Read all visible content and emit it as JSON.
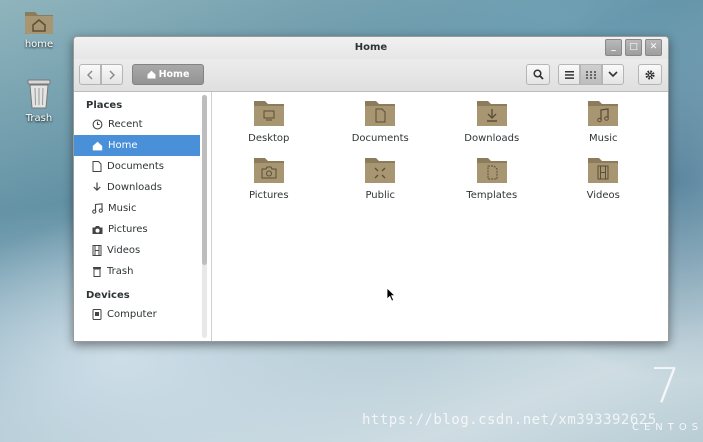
{
  "desktop": {
    "home_label": "home",
    "trash_label": "Trash"
  },
  "window": {
    "title": "Home",
    "controls": [
      "_",
      "□",
      "✕"
    ]
  },
  "toolbar": {
    "path_label": "Home"
  },
  "sidebar": {
    "places_heading": "Places",
    "items": [
      {
        "label": "Recent",
        "icon": "clock-icon"
      },
      {
        "label": "Home",
        "icon": "home-icon"
      },
      {
        "label": "Documents",
        "icon": "document-icon"
      },
      {
        "label": "Downloads",
        "icon": "download-icon"
      },
      {
        "label": "Music",
        "icon": "music-icon"
      },
      {
        "label": "Pictures",
        "icon": "camera-icon"
      },
      {
        "label": "Videos",
        "icon": "film-icon"
      },
      {
        "label": "Trash",
        "icon": "trash-icon"
      }
    ],
    "active_item": "Home",
    "devices_heading": "Devices",
    "devices": [
      {
        "label": "Computer",
        "icon": "drive-icon"
      }
    ]
  },
  "files": [
    {
      "name": "Desktop",
      "icon": "desktop-folder-icon"
    },
    {
      "name": "Documents",
      "icon": "documents-folder-icon"
    },
    {
      "name": "Downloads",
      "icon": "downloads-folder-icon"
    },
    {
      "name": "Music",
      "icon": "music-folder-icon"
    },
    {
      "name": "Pictures",
      "icon": "pictures-folder-icon"
    },
    {
      "name": "Public",
      "icon": "public-folder-icon"
    },
    {
      "name": "Templates",
      "icon": "templates-folder-icon"
    },
    {
      "name": "Videos",
      "icon": "videos-folder-icon"
    }
  ],
  "branding": {
    "version": "7",
    "os_name": "CENTOS",
    "watermark": "https://blog.csdn.net/xm393392625"
  },
  "colors": {
    "selection": "#4a90d9",
    "folder": "#a89572"
  }
}
